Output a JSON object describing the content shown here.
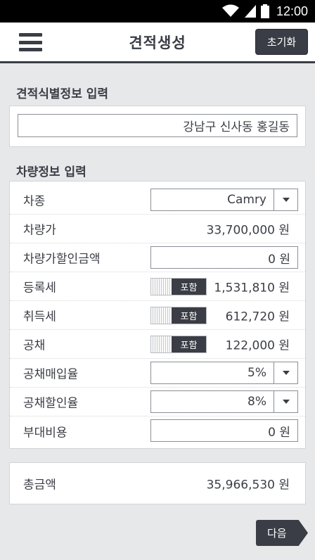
{
  "status_bar": {
    "time": "12:00",
    "icons": [
      "wifi-icon",
      "signal-icon",
      "battery-icon"
    ]
  },
  "header": {
    "title": "견적생성",
    "reset_label": "초기화",
    "menu_icon": "hamburger-menu-icon"
  },
  "identification": {
    "section_title": "견적식별정보 입력",
    "input_value": "강남구 신사동 홍길동"
  },
  "vehicle": {
    "section_title": "차량정보 입력",
    "rows": [
      {
        "label": "차종",
        "value": "Camry"
      },
      {
        "label": "차량가",
        "value": "33,700,000 원"
      },
      {
        "label": "차량가할인금액",
        "value": "0 원"
      },
      {
        "label": "등록세",
        "toggle": "포함",
        "value": "1,531,810 원"
      },
      {
        "label": "취득세",
        "toggle": "포함",
        "value": "612,720 원"
      },
      {
        "label": "공채",
        "toggle": "포함",
        "value": "122,000 원"
      },
      {
        "label": "공채매입율",
        "value": "5%"
      },
      {
        "label": "공채할인율",
        "value": "8%"
      },
      {
        "label": "부대비용",
        "value": "0 원"
      }
    ]
  },
  "total": {
    "label": "총금액",
    "value": "35,966,530 원"
  },
  "footer": {
    "next_label": "다음"
  },
  "colors": {
    "primary_dark": "#3a3d45",
    "background": "#e7e8ea"
  }
}
